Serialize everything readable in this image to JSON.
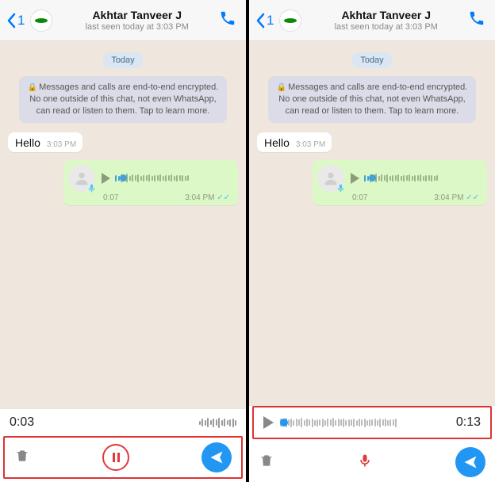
{
  "header": {
    "back_count": "1",
    "contact_name": "Akhtar Tanveer J",
    "status": "last seen today at 3:03 PM"
  },
  "chat": {
    "date_label": "Today",
    "encryption_notice": "Messages and calls are end-to-end encrypted. No one outside of this chat, not even WhatsApp, can read or listen to them. Tap to learn more.",
    "msg1": {
      "text": "Hello",
      "time": "3:03 PM"
    },
    "voice1": {
      "duration": "0:07",
      "time": "3:04 PM"
    }
  },
  "left_footer": {
    "elapsed": "0:03"
  },
  "right_footer": {
    "duration": "0:13"
  }
}
